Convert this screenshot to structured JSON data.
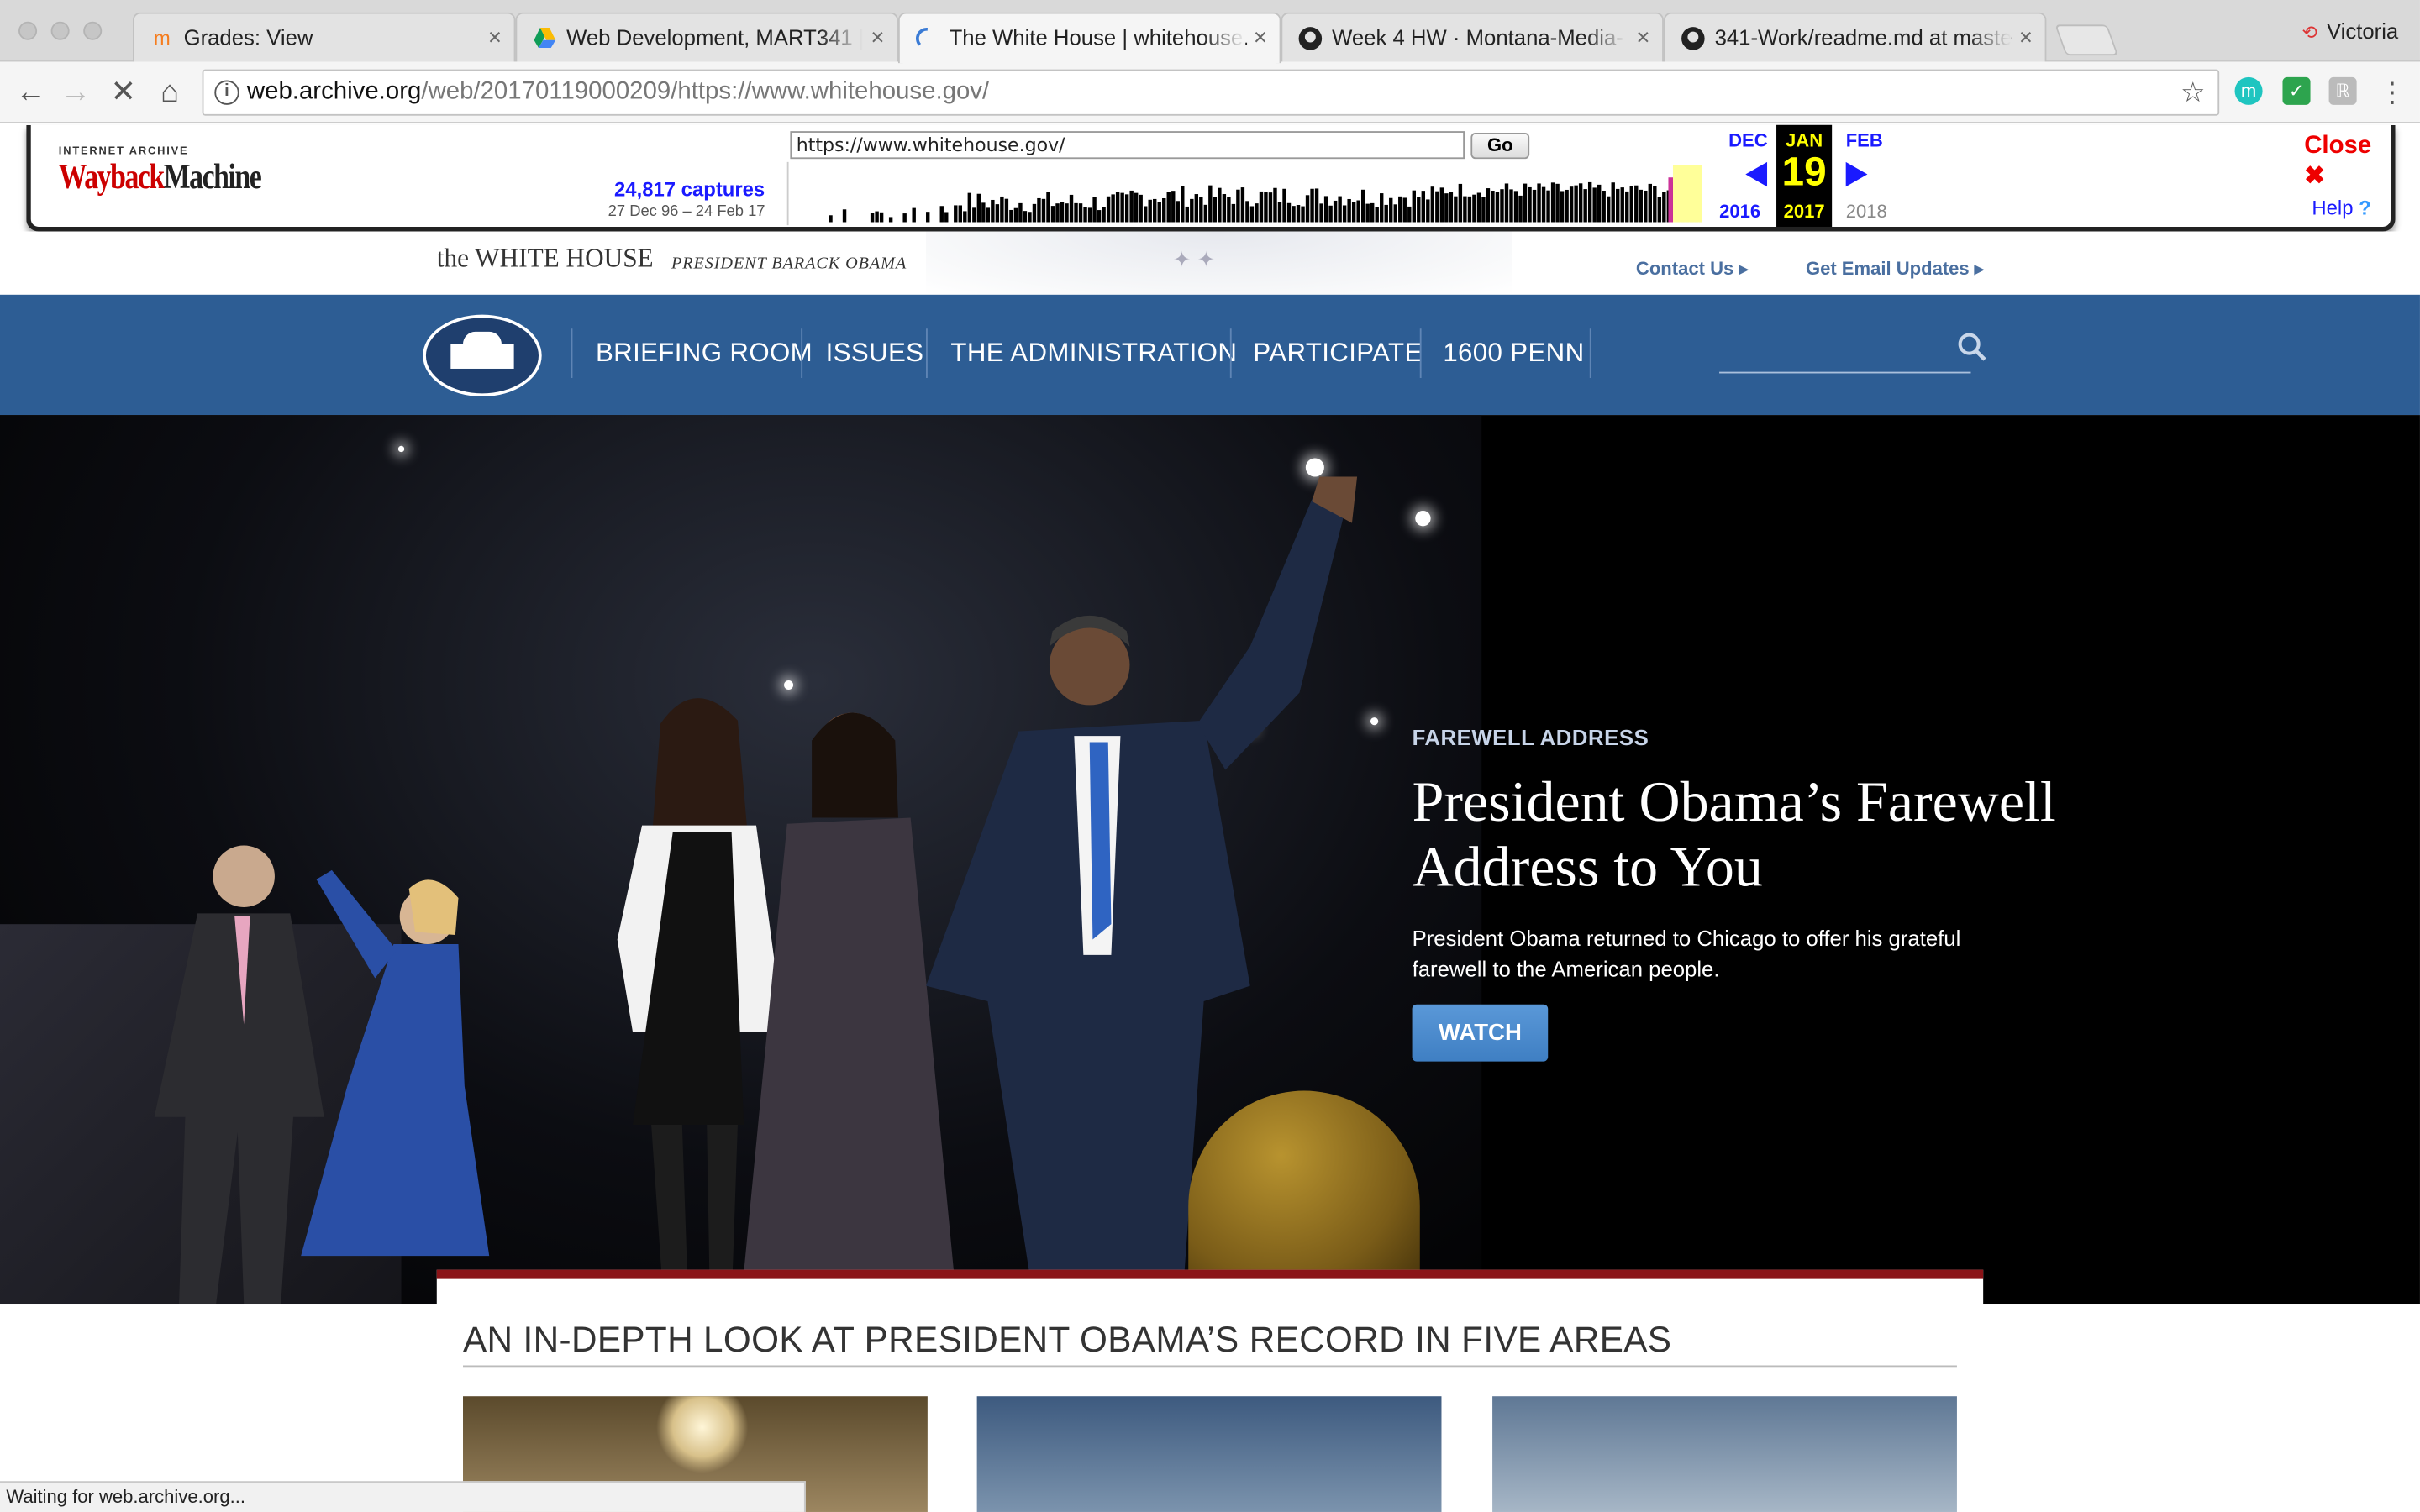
{
  "browser": {
    "tabs": [
      {
        "label": "Grades: View",
        "icon": "moodle-icon"
      },
      {
        "label": "Web Development, MART341 |",
        "icon": "google-drive-icon"
      },
      {
        "label": "The White House | whitehouse.",
        "icon": "loading-spinner-icon"
      },
      {
        "label": "Week 4 HW · Montana-Media-",
        "icon": "github-icon"
      },
      {
        "label": "341-Work/readme.md at maste",
        "icon": "github-icon"
      }
    ],
    "profile_name": "Victoria",
    "url_domain": "web.archive.org",
    "url_path": "/web/20170119000209/https://www.whitehouse.gov/",
    "status": "Waiting for web.archive.org..."
  },
  "wayback": {
    "logo_top": "INTERNET ARCHIVE",
    "logo_a": "Wayback",
    "logo_b": "Machine",
    "url_value": "https://www.whitehouse.gov/",
    "go_label": "Go",
    "captures": "24,817 captures",
    "range": "27 Dec 96 – 24 Feb 17",
    "prev_month": "DEC",
    "cur_month": "JAN",
    "next_month": "FEB",
    "cur_day": "19",
    "prev_year": "2016",
    "cur_year": "2017",
    "next_year": "2018",
    "close_label": "Close",
    "help_label": "Help"
  },
  "site": {
    "name": "the WHITE HOUSE",
    "president": "PRESIDENT BARACK OBAMA",
    "contact": "Contact Us ▸",
    "email": "Get Email Updates ▸",
    "nav": [
      "BRIEFING ROOM",
      "ISSUES",
      "THE ADMINISTRATION",
      "PARTICIPATE",
      "1600 PENN"
    ]
  },
  "hero": {
    "kicker": "FAREWELL ADDRESS",
    "title": "President Obama’s Farewell Address to You",
    "description": "President Obama returned to Chicago to offer his grateful farewell to the American people.",
    "button": "WATCH"
  },
  "record": {
    "title": "AN IN-DEPTH LOOK AT PRESIDENT OBAMA’S RECORD IN FIVE AREAS"
  },
  "colors": {
    "nav_blue": "#2d5d94",
    "accent_red": "#8b1418",
    "button_blue": "#4a8ace",
    "wayback_red": "#cc0000",
    "wayback_blue": "#1a1aff"
  }
}
